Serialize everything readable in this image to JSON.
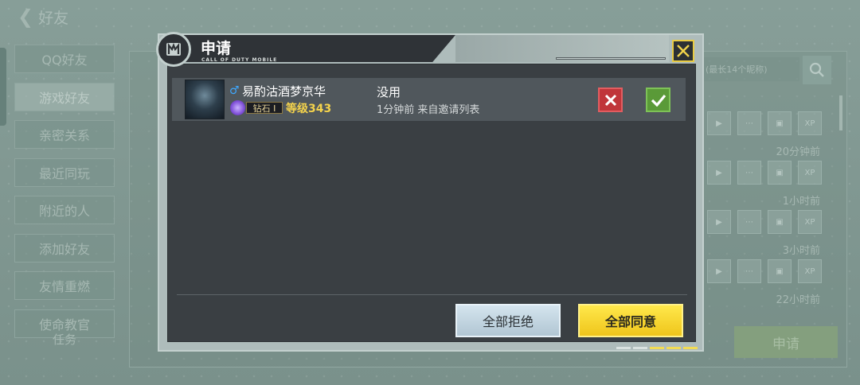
{
  "background": {
    "title": "好友",
    "nav": [
      {
        "label": "QQ好友"
      },
      {
        "label": "游戏好友",
        "active": true
      },
      {
        "label": "亲密关系"
      },
      {
        "label": "最近同玩"
      },
      {
        "label": "附近的人"
      },
      {
        "label": "添加好友"
      },
      {
        "label": "友情重燃"
      },
      {
        "label": "使命教官"
      }
    ],
    "nav_sub_label": "任务",
    "search_placeholder": "(最长14个昵称)",
    "row_times": [
      "",
      "20分钟前",
      "1小时前",
      "3小时前",
      "22小时前"
    ],
    "apply_button_label": "申请"
  },
  "dialog": {
    "title": "申请",
    "subtitle": "CALL OF DUTY MOBILE",
    "close_icon": "close-x-icon",
    "request": {
      "gender_symbol": "♂",
      "player_name": "易酌沽酒梦京华",
      "rank": "钻石 I",
      "level": "等级343",
      "message": "没用",
      "meta": "1分钟前 来自邀请列表"
    },
    "reject_all_label": "全部拒绝",
    "accept_all_label": "全部同意"
  },
  "colors": {
    "accent_yellow": "#f4d34c",
    "reject_red": "#c0353a",
    "accept_green": "#5a9a38",
    "panel_dark": "#3a3f43"
  }
}
